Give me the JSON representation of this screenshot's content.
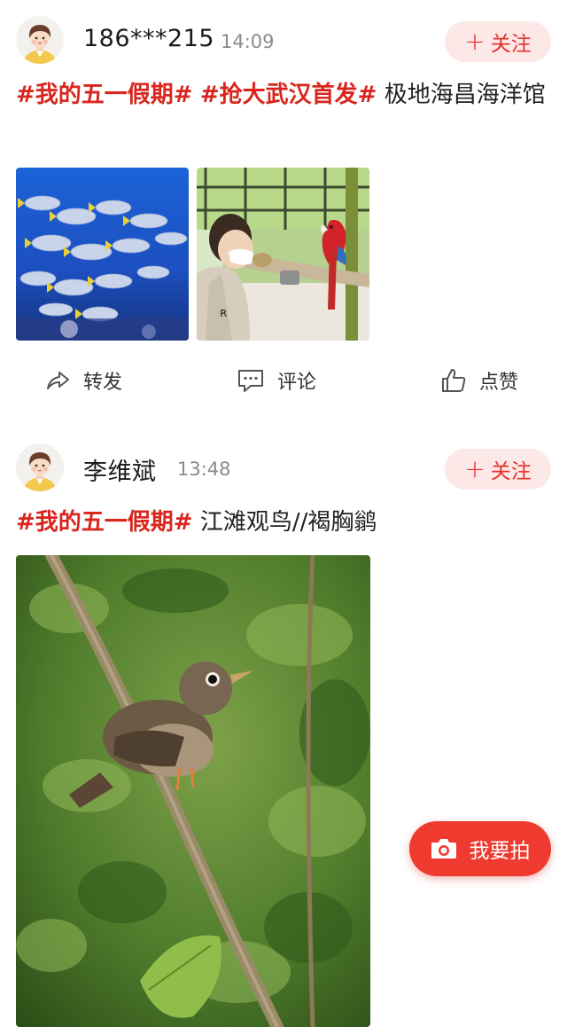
{
  "posts": [
    {
      "username": "186***215",
      "time": "14:09",
      "follow_label": "关注",
      "text": {
        "hashtags": [
          "#我的五一假期#",
          "#抢大武汉首发#"
        ],
        "body": "极地海昌海洋馆"
      },
      "images": [
        "fish-school-aquarium-photo",
        "child-and-parrot-photo"
      ],
      "actions": {
        "share": "转发",
        "comment": "评论",
        "like": "点赞"
      }
    },
    {
      "username": "李维斌",
      "time": "13:48",
      "follow_label": "关注",
      "text": {
        "hashtags": [
          "#我的五一假期#"
        ],
        "body": "江滩观鸟//褐胸鹟"
      },
      "images": [
        "brown-breasted-flycatcher-photo"
      ]
    }
  ],
  "fab": {
    "label": "我要拍",
    "icon": "camera-icon"
  },
  "colors": {
    "hashtag": "#d8261e",
    "follow_bg": "#fde8e8",
    "follow_text": "#e5312c",
    "fab_bg": "#ee3a2f"
  }
}
